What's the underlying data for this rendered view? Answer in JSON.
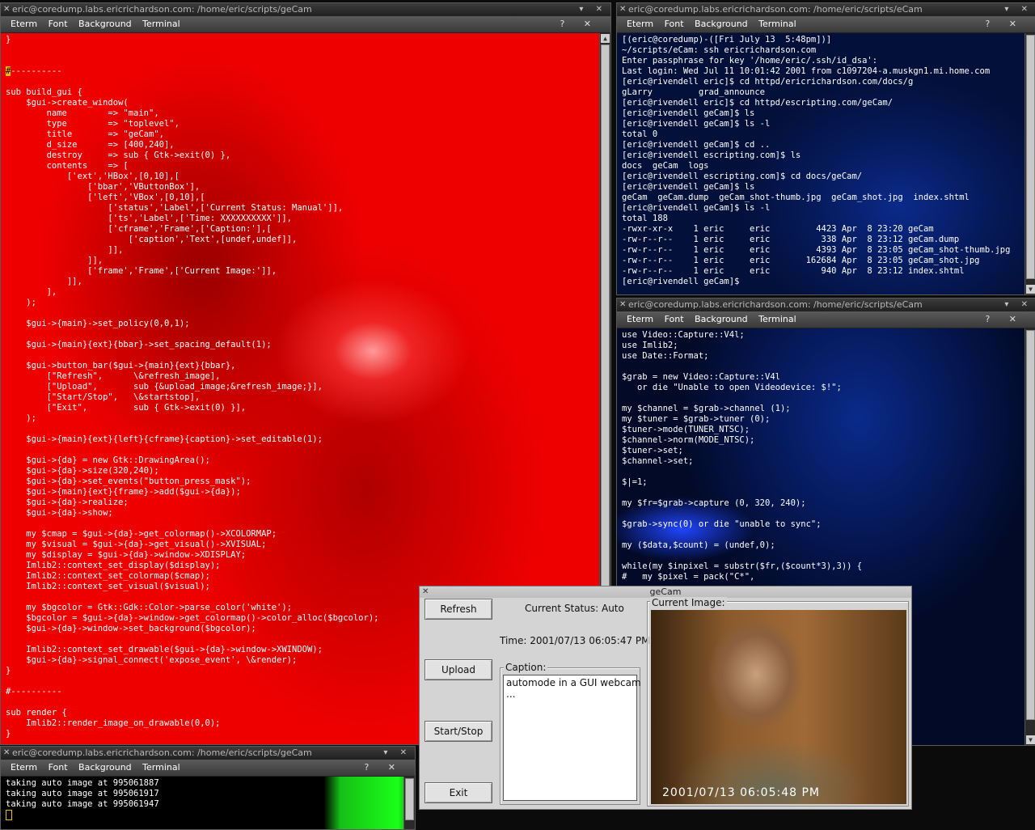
{
  "menu": [
    "Eterm",
    "Font",
    "Background",
    "Terminal"
  ],
  "menu_right": "?  ✕",
  "titlebar_buttons": "▾ ✕",
  "win_main": {
    "title": "eric@coredump.labs.ericrichardson.com: /home/eric/scripts/geCam",
    "lines": [
      "}",
      "",
      "",
      "#----------",
      "",
      "sub build_gui {",
      "    $gui->create_window(",
      "        name        => \"main\",",
      "        type        => \"toplevel\",",
      "        title       => \"geCam\",",
      "        d_size      => [400,240],",
      "        destroy     => sub { Gtk->exit(0) },",
      "        contents    => [",
      "            ['ext','HBox',[0,10],[",
      "                ['bbar','VButtonBox'],",
      "                ['left','VBox',[0,10],[",
      "                    ['status','Label',['Current Status: Manual']],",
      "                    ['ts','Label',['Time: XXXXXXXXXX']],",
      "                    ['cframe','Frame',['Caption:'],[",
      "                        ['caption','Text',[undef,undef]],",
      "                    ]],",
      "                ]],",
      "                ['frame','Frame',['Current Image:']],",
      "            ]],",
      "        ],",
      "    );",
      "",
      "    $gui->{main}->set_policy(0,0,1);",
      "",
      "    $gui->{main}{ext}{bbar}->set_spacing_default(1);",
      "",
      "    $gui->button_bar($gui->{main}{ext}{bbar},",
      "        [\"Refresh\",      \\&refresh_image],",
      "        [\"Upload\",       sub {&upload_image;&refresh_image;}],",
      "        [\"Start/Stop\",   \\&startstop],",
      "        [\"Exit\",         sub { Gtk->exit(0) }],",
      "    );",
      "",
      "    $gui->{main}{ext}{left}{cframe}{caption}->set_editable(1);",
      "",
      "    $gui->{da} = new Gtk::DrawingArea();",
      "    $gui->{da}->size(320,240);",
      "    $gui->{da}->set_events(\"button_press_mask\");",
      "    $gui->{main}{ext}{frame}->add($gui->{da});",
      "    $gui->{da}->realize;",
      "    $gui->{da}->show;",
      "",
      "    my $cmap = $gui->{da}->get_colormap()->XCOLORMAP;",
      "    my $visual = $gui->{da}->get_visual()->XVISUAL;",
      "    my $display = $gui->{da}->window->XDISPLAY;",
      "    Imlib2::context_set_display($display);",
      "    Imlib2::context_set_colormap($cmap);",
      "    Imlib2::context_set_visual($visual);",
      "",
      "    my $bgcolor = Gtk::Gdk::Color->parse_color('white');",
      "    $bgcolor = $gui->{da}->window->get_colormap()->color_alloc($bgcolor);",
      "    $gui->{da}->window->set_background($bgcolor);",
      "",
      "    Imlib2::context_set_drawable($gui->{da}->window->XWINDOW);",
      "    $gui->{da}->signal_connect('expose_event', \\&render);",
      "}",
      "",
      "#----------",
      "",
      "sub render {",
      "    Imlib2::render_image_on_drawable(0,0);",
      "}"
    ]
  },
  "win_tr": {
    "title": "eric@coredump.labs.ericrichardson.com: /home/eric/scripts/eCam",
    "lines": [
      "[(eric@coredump)-([Fri July 13  5:48pm])]",
      "~/scripts/eCam: ssh ericrichardson.com",
      "Enter passphrase for key '/home/eric/.ssh/id_dsa':",
      "Last login: Wed Jul 11 10:01:42 2001 from c1097204-a.muskgn1.mi.home.com",
      "[eric@rivendell eric]$ cd httpd/ericrichardson.com/docs/g",
      "gLarry         grad_announce",
      "[eric@rivendell eric]$ cd httpd/escripting.com/geCam/",
      "[eric@rivendell geCam]$ ls",
      "[eric@rivendell geCam]$ ls -l",
      "total 0",
      "[eric@rivendell geCam]$ cd ..",
      "[eric@rivendell escripting.com]$ ls",
      "docs  geCam  logs",
      "[eric@rivendell escripting.com]$ cd docs/geCam/",
      "[eric@rivendell geCam]$ ls",
      "geCam  geCam.dump  geCam_shot-thumb.jpg  geCam_shot.jpg  index.shtml",
      "[eric@rivendell geCam]$ ls -l",
      "total 188",
      "-rwxr-xr-x    1 eric     eric         4423 Apr  8 23:20 geCam",
      "-rw-r--r--    1 eric     eric          338 Apr  8 23:12 geCam.dump",
      "-rw-r--r--    1 eric     eric         4393 Apr  8 23:05 geCam_shot-thumb.jpg",
      "-rw-r--r--    1 eric     eric       162684 Apr  8 23:05 geCam_shot.jpg",
      "-rw-r--r--    1 eric     eric          940 Apr  8 23:12 index.shtml",
      "[eric@rivendell geCam]$ "
    ]
  },
  "win_mr": {
    "title": "eric@coredump.labs.ericrichardson.com: /home/eric/scripts/eCam",
    "lines": [
      "use Video::Capture::V4l;",
      "use Imlib2;",
      "use Date::Format;",
      "",
      "$grab = new Video::Capture::V4l",
      "   or die \"Unable to open Videodevice: $!\";",
      "",
      "my $channel = $grab->channel (1);",
      "my $tuner = $grab->tuner (0);",
      "$tuner->mode(TUNER_NTSC);",
      "$channel->norm(MODE_NTSC);",
      "$tuner->set;",
      "$channel->set;",
      "",
      "$|=1;",
      "",
      "my $fr=$grab->capture (0, 320, 240);",
      "",
      "$grab->sync(0) or die \"unable to sync\";",
      "",
      "my ($data,$count) = (undef,0);",
      "",
      "while(my $inpixel = substr($fr,($count*3),3)) {",
      "#   my $pixel = pack(\"C*\","
    ]
  },
  "win_bl": {
    "title": "eric@coredump.labs.ericrichardson.com: /home/eric/scripts/geCam",
    "lines": [
      "taking auto image at 995061887",
      "taking auto image at 995061917",
      "taking auto image at 995061947"
    ]
  },
  "gecam": {
    "title": "geCam",
    "buttons": {
      "refresh": "Refresh",
      "upload": "Upload",
      "startstop": "Start/Stop",
      "exit": "Exit"
    },
    "status": "Current Status: Auto",
    "time": "Time: 2001/07/13 06:05:47 PM",
    "caption_label": "Caption:",
    "caption_text": "automode in a GUI webcam\n...",
    "image_label": "Current Image:",
    "image_stamp": "2001/07/13 06:05:48 PM"
  }
}
